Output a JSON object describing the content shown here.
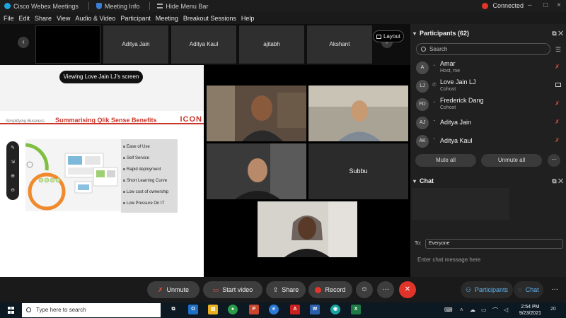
{
  "titlebar": {
    "app_title": "Cisco Webex Meetings",
    "meeting_info": "Meeting Info",
    "hide_menu": "Hide Menu Bar",
    "connection": "Connected",
    "minimize": "–",
    "maximize": "□",
    "close": "×"
  },
  "menu": [
    "File",
    "Edit",
    "Share",
    "View",
    "Audio & Video",
    "Participant",
    "Meeting",
    "Breakout Sessions",
    "Help"
  ],
  "strip": {
    "tiles": [
      "Aditya Jain",
      "Aditya Kaul",
      "ajitabh",
      "Akshant"
    ],
    "prev": "‹",
    "next": "›",
    "layout_label": "Layout"
  },
  "share": {
    "viewing_label": "Viewing Love Jain LJ's screen",
    "slide": {
      "subtitle": "Simplifying Business",
      "title": "Summarising Qlik Sense Benefits",
      "logo": "ICON",
      "benefits": [
        "Ease of Use",
        "Self Service",
        "Rapid deployment",
        "Short Learning Curve",
        "Low cost of ownership",
        "Low Pressure On IT"
      ]
    },
    "tools": [
      "✎",
      "⇲",
      "⊕",
      "⊖"
    ]
  },
  "grid": {
    "subbu_label": "Subbu"
  },
  "participants": {
    "header": "Participants (62)",
    "search_placeholder": "Search",
    "list": [
      {
        "initials": "A",
        "name": "Amar",
        "role": "Host, me"
      },
      {
        "initials": "LJ",
        "name": "Love Jain LJ",
        "role": "Cohost"
      },
      {
        "initials": "FD",
        "name": "Frederick Dang",
        "role": "Cohost"
      },
      {
        "initials": "AJ",
        "name": "Aditya Jain",
        "role": ""
      },
      {
        "initials": "AK",
        "name": "Aditya Kaul",
        "role": ""
      }
    ],
    "mute_all": "Mute all",
    "unmute_all": "Unmute all",
    "more": "···"
  },
  "chat": {
    "header": "Chat",
    "to_label": "To:",
    "to_value": "Everyone",
    "input_placeholder": "Enter chat message here"
  },
  "controls": {
    "unmute": "Unmute",
    "start_video": "Start video",
    "share": "Share",
    "record": "Record",
    "reactions": "☺",
    "more": "···",
    "leave": "✕",
    "participants": "Participants",
    "chat": "Chat",
    "more_right": "···"
  },
  "taskbar": {
    "search_placeholder": "Type here to search",
    "time": "2:54 PM",
    "date": "9/23/2021",
    "notifications": "20",
    "apps": [
      {
        "name": "task-view",
        "label": "⧉",
        "color": "#0c1822"
      },
      {
        "name": "outlook",
        "label": "O",
        "color": "#1f6fc4"
      },
      {
        "name": "file-explorer",
        "label": "▤",
        "color": "#e8b021"
      },
      {
        "name": "chrome",
        "label": "●",
        "color": "#2b9b4a"
      },
      {
        "name": "powerpoint",
        "label": "P",
        "color": "#c8462d"
      },
      {
        "name": "edge",
        "label": "e",
        "color": "#2d7bd6"
      },
      {
        "name": "acrobat",
        "label": "A",
        "color": "#c8201c"
      },
      {
        "name": "word",
        "label": "W",
        "color": "#2b5faa"
      },
      {
        "name": "webex",
        "label": "◉",
        "color": "#1aa3a0"
      },
      {
        "name": "excel",
        "label": "X",
        "color": "#1e7a44"
      }
    ]
  }
}
